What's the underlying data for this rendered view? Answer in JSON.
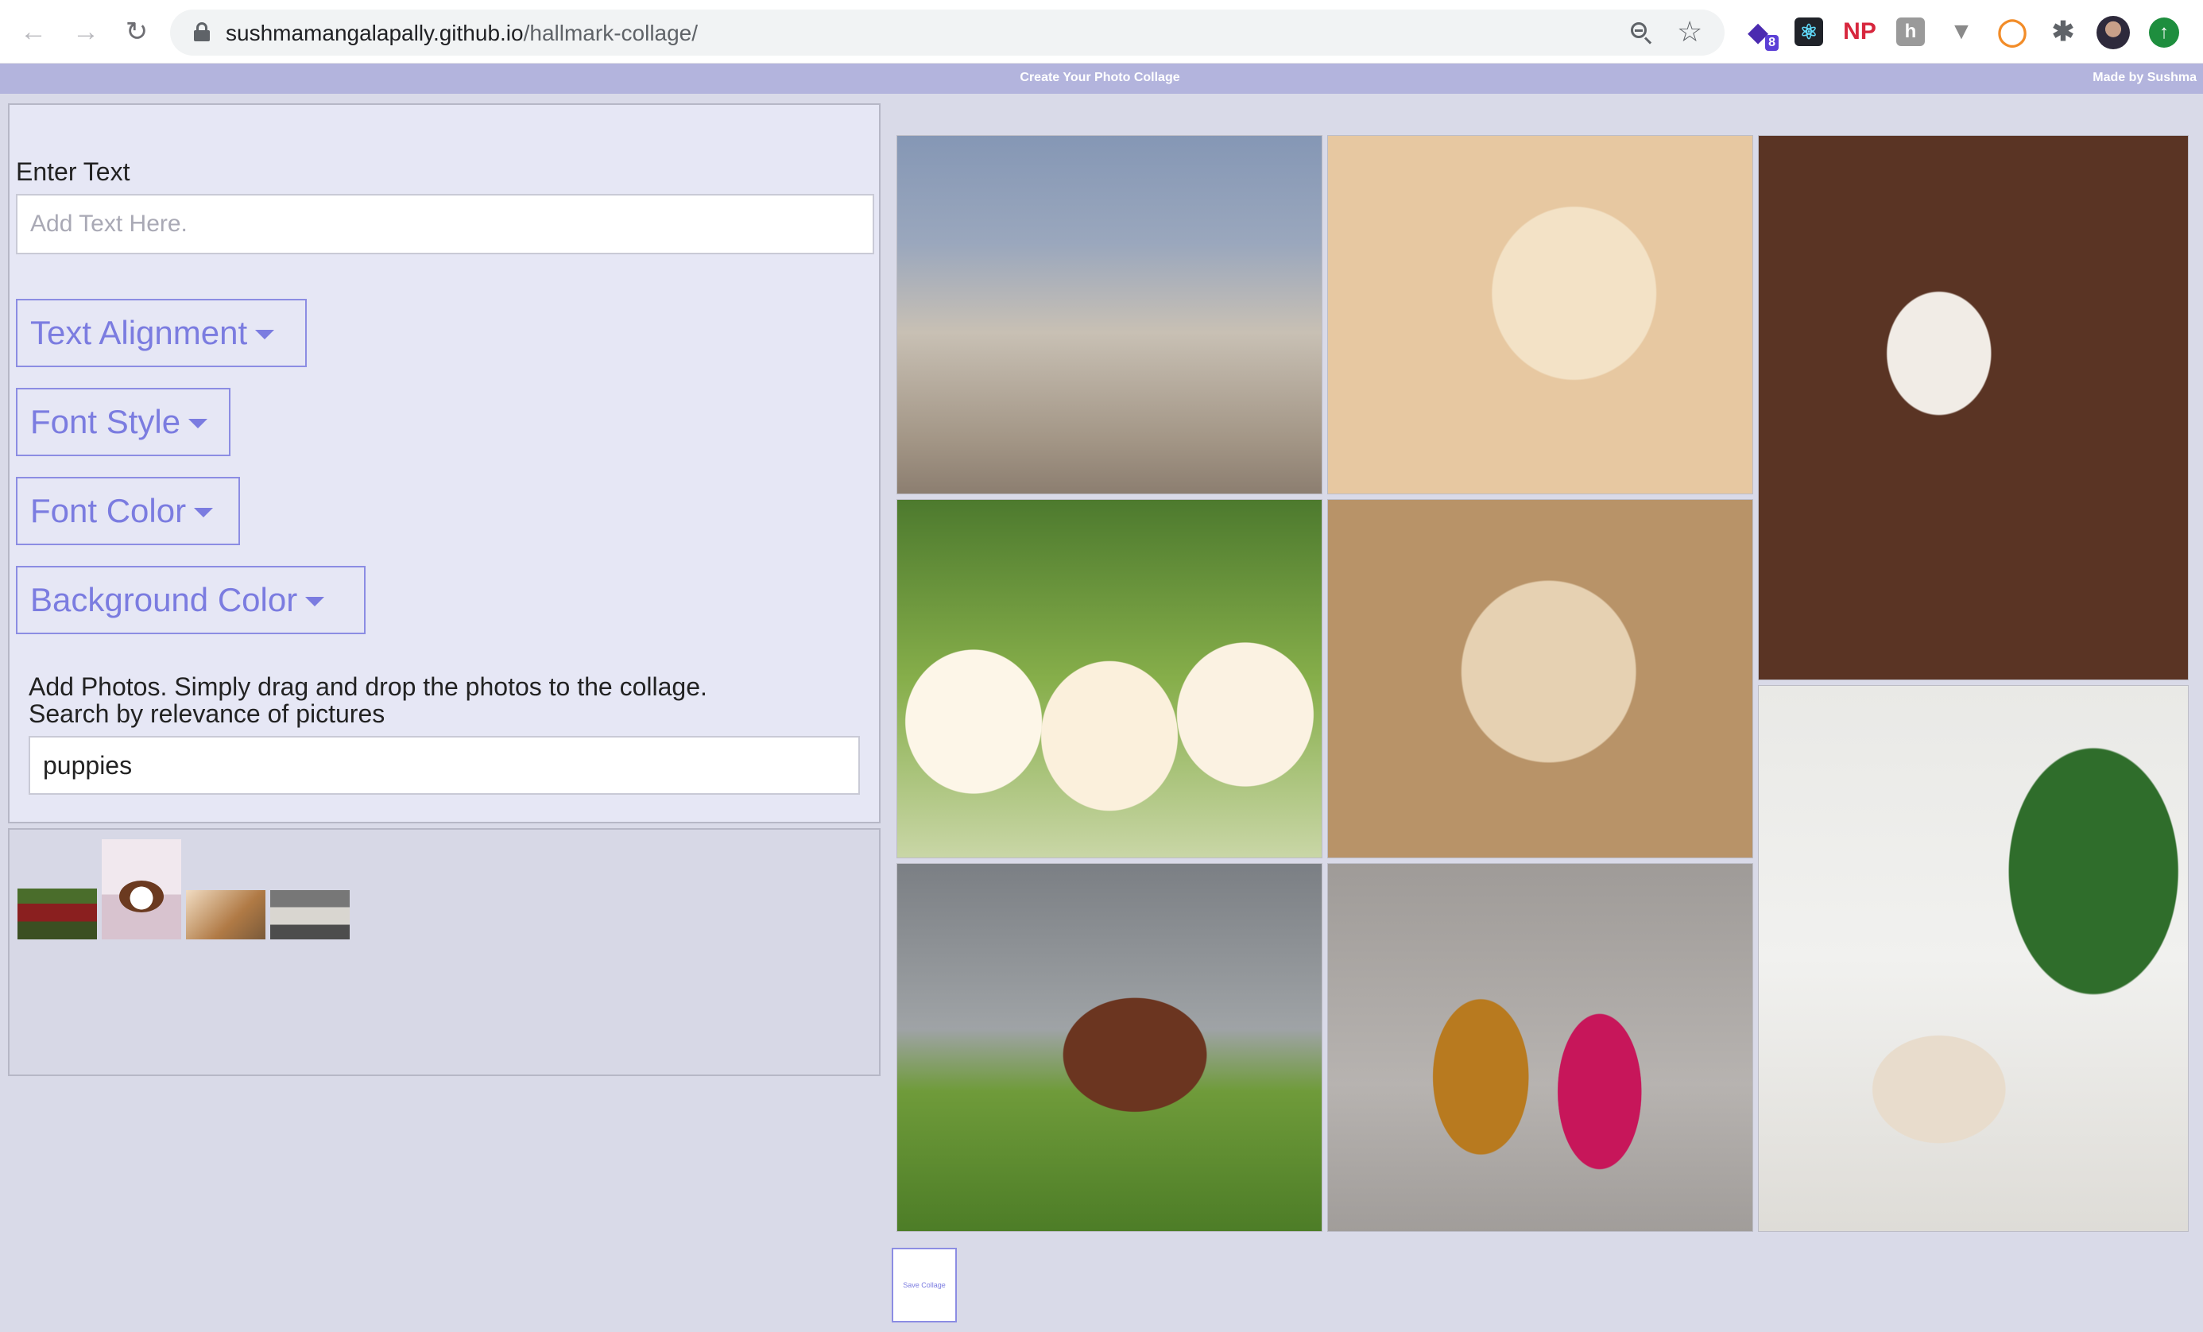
{
  "browser": {
    "url_host": "sushmamangalapally.github.io",
    "url_path": "/hallmark-collage/",
    "extension_badge": "8",
    "ext_np": "NP",
    "ext_h": "h"
  },
  "header": {
    "title": "Create Your Photo Collage",
    "credit": "Made by Sushma"
  },
  "editor": {
    "enter_text_label": "Enter Text",
    "text_placeholder": "Add Text Here.",
    "dropdowns": {
      "text_alignment": "Text Alignment",
      "font_style": "Font Style",
      "font_color": "Font Color",
      "background_color": "Background Color"
    },
    "photos_help_line1": "Add Photos. Simply drag and drop the photos to the collage.",
    "photos_help_line2": "Search by relevance of pictures",
    "search_value": "puppies"
  },
  "actions": {
    "save_label": "Save Collage"
  },
  "colors": {
    "accent": "#7b7ce0",
    "header_bar": "#b3b4dd",
    "panel": "#e6e7f5"
  }
}
